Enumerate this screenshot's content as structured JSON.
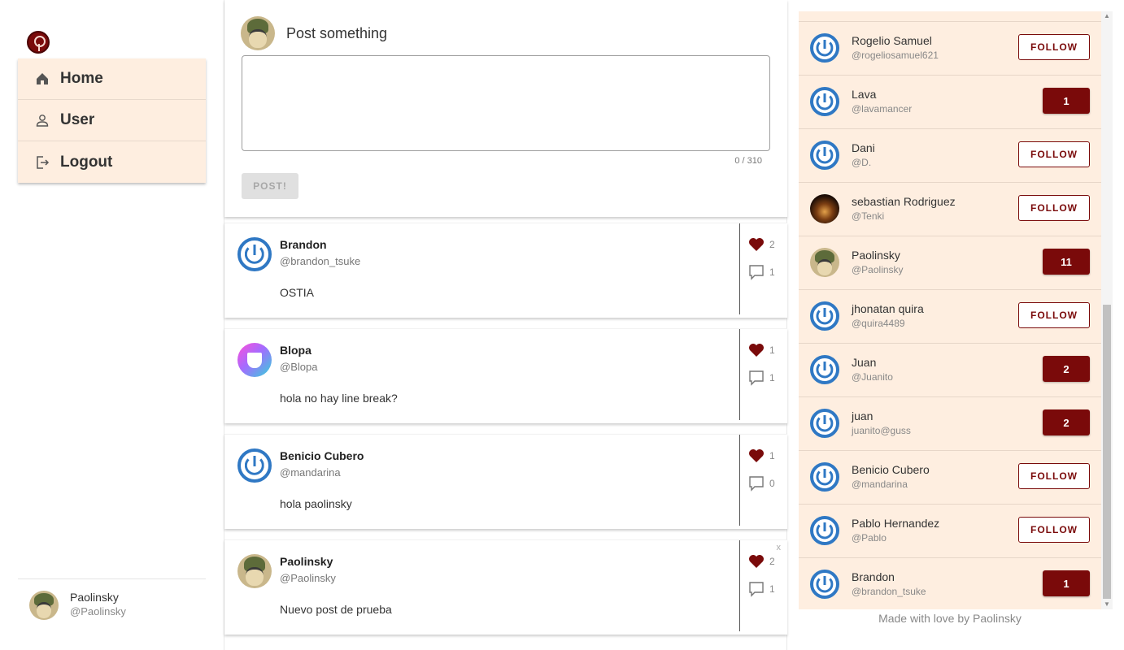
{
  "nav": {
    "items": [
      {
        "label": "Home",
        "icon": "home-icon"
      },
      {
        "label": "User",
        "icon": "user-icon"
      },
      {
        "label": "Logout",
        "icon": "logout-icon"
      }
    ]
  },
  "current_user": {
    "name": "Paolinsky",
    "handle": "@Paolinsky"
  },
  "composer": {
    "title": "Post something",
    "counter": "0 / 310",
    "post_label": "POST!"
  },
  "posts": [
    {
      "author": "Brandon",
      "handle": "@brandon_tsuke",
      "body": "OSTIA",
      "likes": "2",
      "comments": "1"
    },
    {
      "author": "Blopa",
      "handle": "@Blopa",
      "body": "hola no hay line break?",
      "likes": "1",
      "comments": "1"
    },
    {
      "author": "Benicio Cubero",
      "handle": "@mandarina",
      "body": "hola paolinsky",
      "likes": "1",
      "comments": "0"
    },
    {
      "author": "Paolinsky",
      "handle": "@Paolinsky",
      "body": "Nuevo post de prueba",
      "likes": "2",
      "comments": "1",
      "close": "x"
    }
  ],
  "users": [
    {
      "name": "Rogelio Samuel",
      "handle": "@rogeliosamuel621",
      "button": "FOLLOW"
    },
    {
      "name": "Lava",
      "handle": "@lavamancer",
      "button": "1"
    },
    {
      "name": "Dani",
      "handle": "@D.",
      "button": "FOLLOW"
    },
    {
      "name": "sebastian Rodriguez",
      "handle": "@Tenki",
      "button": "FOLLOW"
    },
    {
      "name": "Paolinsky",
      "handle": "@Paolinsky",
      "button": "11"
    },
    {
      "name": "jhonatan quira",
      "handle": "@quira4489",
      "button": "FOLLOW"
    },
    {
      "name": "Juan",
      "handle": "@Juanito",
      "button": "2"
    },
    {
      "name": "juan",
      "handle": "juanito@guss",
      "button": "2"
    },
    {
      "name": "Benicio Cubero",
      "handle": "@mandarina",
      "button": "FOLLOW"
    },
    {
      "name": "Pablo Hernandez",
      "handle": "@Pablo",
      "button": "FOLLOW"
    },
    {
      "name": "Brandon",
      "handle": "@brandon_tsuke",
      "button": "1"
    }
  ],
  "footer": "Made with love by Paolinsky",
  "colors": {
    "accent": "#7a0a0a",
    "panel": "#feeee0",
    "avatar_blue": "#2f78c4"
  }
}
